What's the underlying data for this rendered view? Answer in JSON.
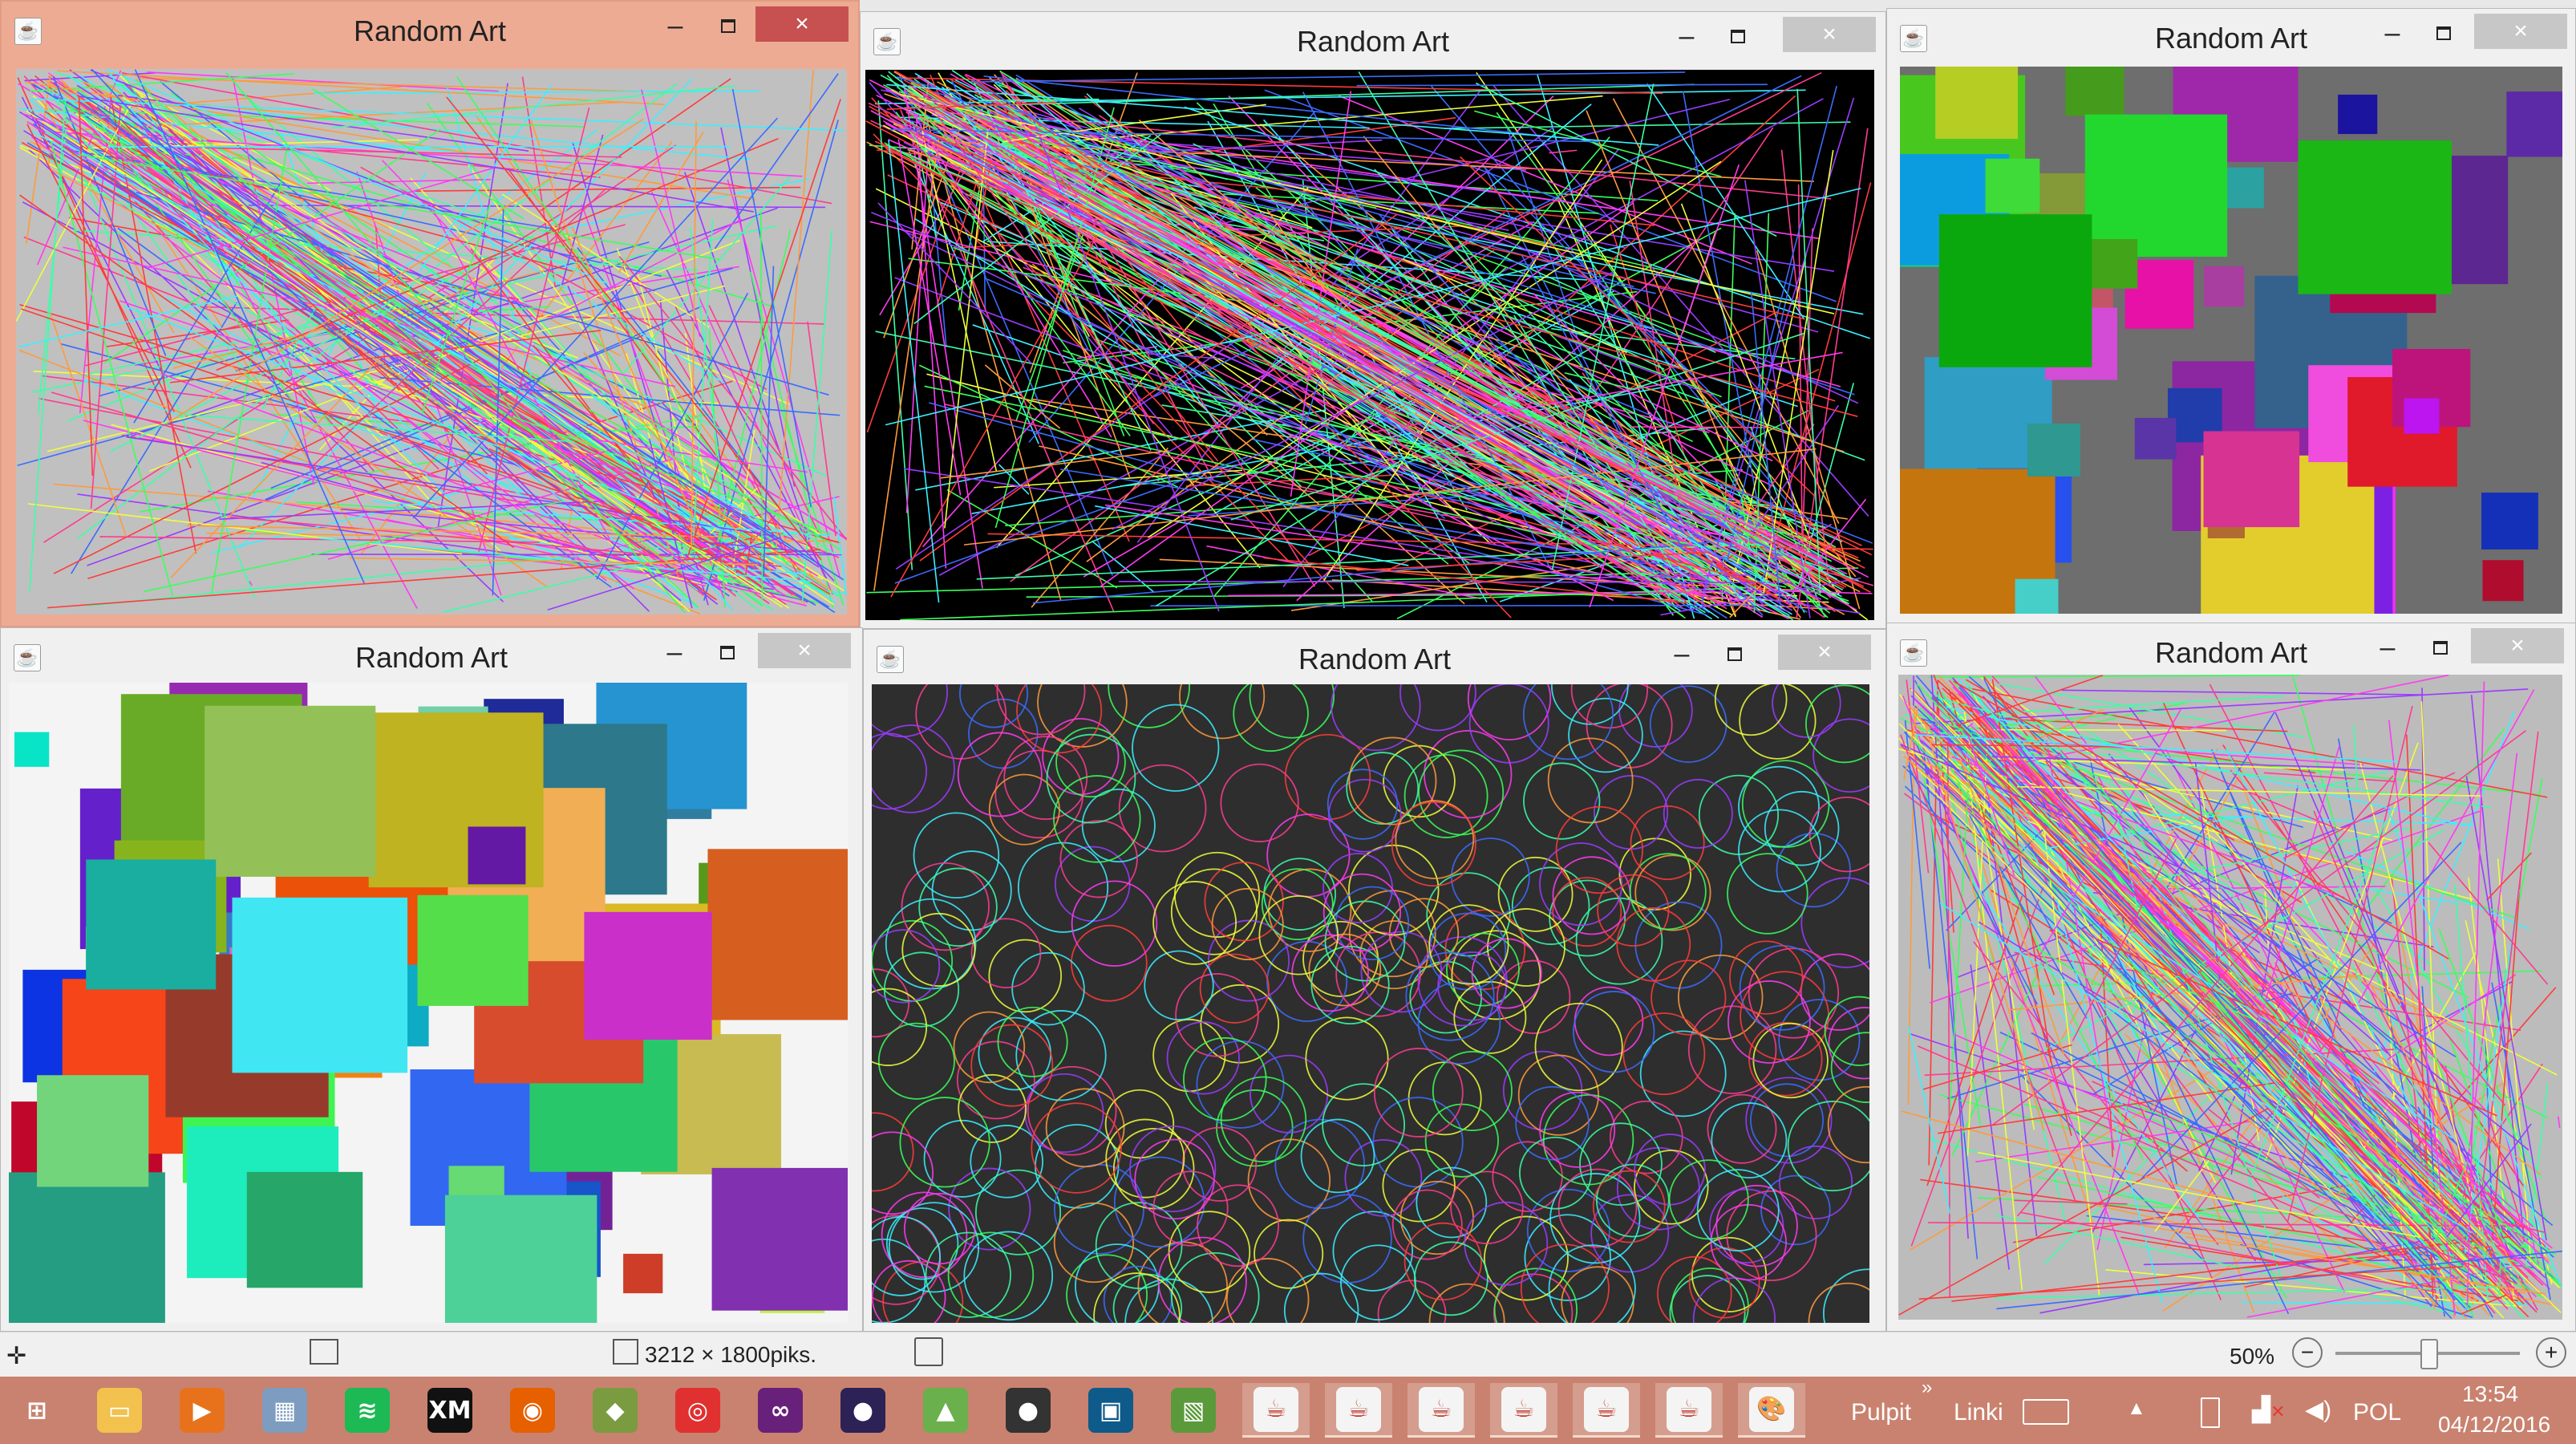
{
  "windows": [
    {
      "id": "w1",
      "title": "Random Art",
      "active": true,
      "canvas_bg": "#c0c0c0",
      "art": "lines"
    },
    {
      "id": "w2",
      "title": "Random Art",
      "active": false,
      "canvas_bg": "#000000",
      "art": "lines"
    },
    {
      "id": "w3",
      "title": "Random Art",
      "active": false,
      "canvas_bg": "#6e6e6e",
      "art": "rects"
    },
    {
      "id": "w4",
      "title": "Random Art",
      "active": false,
      "canvas_bg": "#f4f4f4",
      "art": "rects"
    },
    {
      "id": "w5",
      "title": "Random Art",
      "active": false,
      "canvas_bg": "#2e2e2e",
      "art": "circles"
    },
    {
      "id": "w6",
      "title": "Random Art",
      "active": false,
      "canvas_bg": "#bcbcbc",
      "art": "lines"
    }
  ],
  "window_buttons": {
    "minimize": "–",
    "close": "×"
  },
  "statusbar": {
    "dimensions": "3212 × 1800piks.",
    "zoom": "50%",
    "zoom_out": "−",
    "zoom_in": "+",
    "zoom_level": 0.5
  },
  "taskbar": {
    "apps": [
      {
        "name": "windows-start-icon",
        "glyph": "⊞",
        "color": "#c9826f"
      },
      {
        "name": "file-explorer-icon",
        "glyph": "▭",
        "color": "#f2c14e"
      },
      {
        "name": "media-player-icon",
        "glyph": "▶",
        "color": "#e8721c"
      },
      {
        "name": "calculator-icon",
        "glyph": "▦",
        "color": "#7e9cc0"
      },
      {
        "name": "spotify-icon",
        "glyph": "≋",
        "color": "#1db954"
      },
      {
        "name": "xm-icon",
        "glyph": "XM",
        "color": "#111111"
      },
      {
        "name": "firefox-icon",
        "glyph": "◉",
        "color": "#e66000"
      },
      {
        "name": "minecraft-icon",
        "glyph": "◆",
        "color": "#7a9b3f"
      },
      {
        "name": "camera-app-icon",
        "glyph": "◎",
        "color": "#e03030"
      },
      {
        "name": "visual-studio-icon",
        "glyph": "∞",
        "color": "#68217a"
      },
      {
        "name": "eclipse-icon",
        "glyph": "●",
        "color": "#2c2255"
      },
      {
        "name": "android-studio-icon",
        "glyph": "▲",
        "color": "#6ab04c"
      },
      {
        "name": "github-icon",
        "glyph": "●",
        "color": "#333333"
      },
      {
        "name": "kinect-app-icon",
        "glyph": "▣",
        "color": "#0e5a8a"
      },
      {
        "name": "image-viewer-icon",
        "glyph": "▧",
        "color": "#5a9a3a"
      },
      {
        "name": "java-icon",
        "glyph": "☕",
        "color": "#ffffff",
        "open": true
      },
      {
        "name": "java-icon",
        "glyph": "☕",
        "color": "#ffffff",
        "open": true
      },
      {
        "name": "java-icon",
        "glyph": "☕",
        "color": "#ffffff",
        "open": true
      },
      {
        "name": "java-icon",
        "glyph": "☕",
        "color": "#ffffff",
        "open": true
      },
      {
        "name": "java-icon",
        "glyph": "☕",
        "color": "#ffffff",
        "open": true
      },
      {
        "name": "java-icon",
        "glyph": "☕",
        "color": "#ffffff",
        "open": true
      },
      {
        "name": "paint-icon",
        "glyph": "🎨",
        "color": "#ffffff",
        "open": true
      }
    ],
    "toolbars": {
      "desktop": "Pulpit",
      "links": "Linki",
      "chevron": "»"
    },
    "tray": {
      "language": "POL",
      "time": "13:54",
      "date": "04/12/2016"
    }
  },
  "colors": {
    "taskbar": "#c9826f",
    "active_title": "#eeab93",
    "close_active": "#c75050"
  }
}
